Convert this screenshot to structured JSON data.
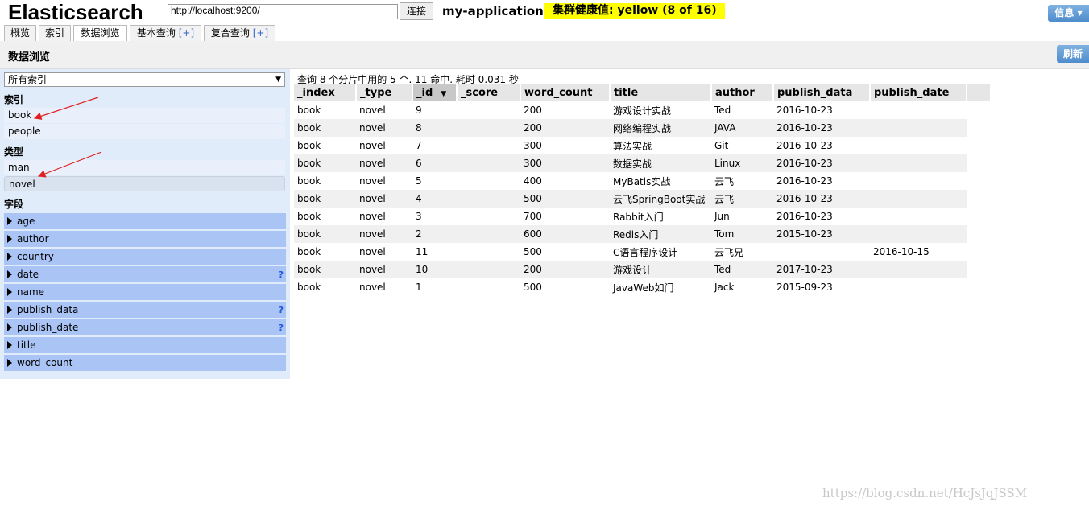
{
  "header": {
    "title": "Elasticsearch",
    "url": "http://localhost:9200/",
    "connect_label": "连接",
    "cluster_name": "my-application",
    "health": "集群健康值: yellow (8 of 16)",
    "info_label": "信息 ▾"
  },
  "tabs": [
    {
      "label": "概览"
    },
    {
      "label": "索引"
    },
    {
      "label": "数据浏览"
    },
    {
      "label": "基本查询",
      "plus": "[+]"
    },
    {
      "label": "复合查询",
      "plus": "[+]"
    }
  ],
  "page": {
    "title": "数据浏览",
    "refresh_label": "刷新"
  },
  "sidebar": {
    "index_select": "所有索引",
    "index_section": "索引",
    "indices": [
      "book",
      "people"
    ],
    "type_section": "类型",
    "types": [
      "man",
      "novel"
    ],
    "field_section": "字段",
    "fields": [
      {
        "name": "age",
        "help": ""
      },
      {
        "name": "author",
        "help": ""
      },
      {
        "name": "country",
        "help": ""
      },
      {
        "name": "date",
        "help": "?"
      },
      {
        "name": "name",
        "help": ""
      },
      {
        "name": "publish_data",
        "help": "?"
      },
      {
        "name": "publish_date",
        "help": "?"
      },
      {
        "name": "title",
        "help": ""
      },
      {
        "name": "word_count",
        "help": ""
      }
    ]
  },
  "results": {
    "summary": "查询 8 个分片中用的 5 个. 11 命中. 耗时 0.031 秒",
    "columns": [
      "_index",
      "_type",
      "_id",
      "_score",
      "word_count",
      "title",
      "author",
      "publish_data",
      "publish_date"
    ],
    "sort_indicator": "▼",
    "rows": [
      [
        "book",
        "novel",
        "9",
        "",
        "200",
        "游戏设计实战",
        "Ted",
        "2016-10-23",
        ""
      ],
      [
        "book",
        "novel",
        "8",
        "",
        "200",
        "网络编程实战",
        "JAVA",
        "2016-10-23",
        ""
      ],
      [
        "book",
        "novel",
        "7",
        "",
        "300",
        "算法实战",
        "Git",
        "2016-10-23",
        ""
      ],
      [
        "book",
        "novel",
        "6",
        "",
        "300",
        "数据实战",
        "Linux",
        "2016-10-23",
        ""
      ],
      [
        "book",
        "novel",
        "5",
        "",
        "400",
        "MyBatis实战",
        "云飞",
        "2016-10-23",
        ""
      ],
      [
        "book",
        "novel",
        "4",
        "",
        "500",
        "云飞SpringBoot实战",
        "云飞",
        "2016-10-23",
        ""
      ],
      [
        "book",
        "novel",
        "3",
        "",
        "700",
        "Rabbit入门",
        "Jun",
        "2016-10-23",
        ""
      ],
      [
        "book",
        "novel",
        "2",
        "",
        "600",
        "Redis入门",
        "Tom",
        "2015-10-23",
        ""
      ],
      [
        "book",
        "novel",
        "11",
        "",
        "500",
        "C语言程序设计",
        "云飞兄",
        "",
        "2016-10-15"
      ],
      [
        "book",
        "novel",
        "10",
        "",
        "200",
        "游戏设计",
        "Ted",
        "2017-10-23",
        ""
      ],
      [
        "book",
        "novel",
        "1",
        "",
        "500",
        "JavaWeb如门",
        "Jack",
        "2015-09-23",
        ""
      ]
    ]
  },
  "watermark": "https://blog.csdn.net/HcJsJqJSSM",
  "colors": {
    "health": "#ffff00",
    "sidebar_bg": "#e1ecfb",
    "field_bg": "#a9c4f5",
    "button_blue": "#4f8ccc",
    "annotation_arrow": "#e02020"
  }
}
